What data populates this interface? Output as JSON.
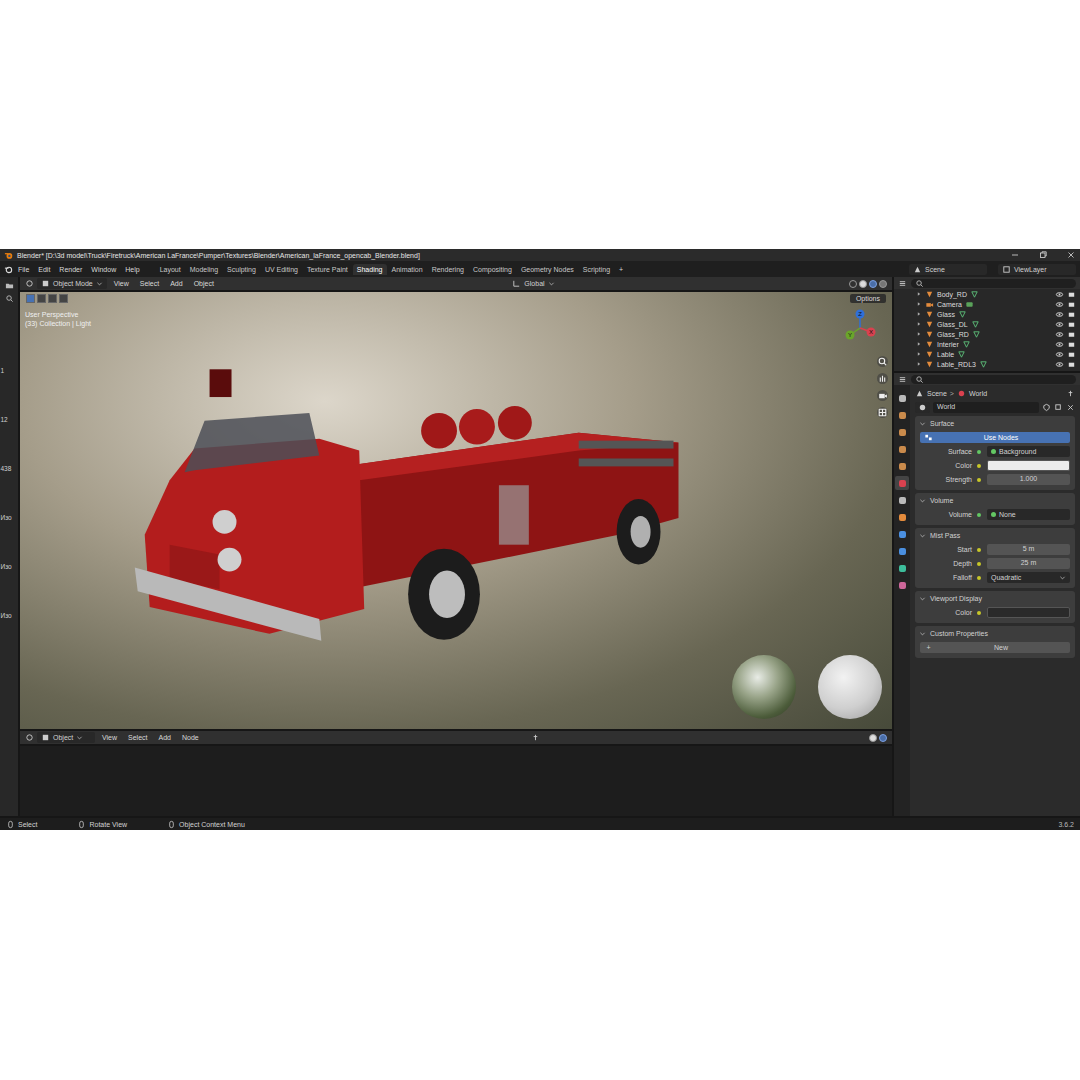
{
  "window": {
    "title": "Blender* [D:\\3d model\\Truck\\Firetruck\\American LaFrance\\Pumper\\Textures\\Blender\\American_laFrance_opencab_Blender.blend]"
  },
  "menu": [
    "File",
    "Edit",
    "Render",
    "Window",
    "Help"
  ],
  "workspaces": [
    {
      "label": "Layout",
      "selected": false
    },
    {
      "label": "Modeling",
      "selected": false
    },
    {
      "label": "Sculpting",
      "selected": false
    },
    {
      "label": "UV Editing",
      "selected": false
    },
    {
      "label": "Texture Paint",
      "selected": false
    },
    {
      "label": "Shading",
      "selected": true
    },
    {
      "label": "Animation",
      "selected": false
    },
    {
      "label": "Rendering",
      "selected": false
    },
    {
      "label": "Compositing",
      "selected": false
    },
    {
      "label": "Geometry Nodes",
      "selected": false
    },
    {
      "label": "Scripting",
      "selected": false
    }
  ],
  "add_workspace": "+",
  "scene": "Scene",
  "view_layer": "ViewLayer",
  "left_strip": [
    "1",
    "12",
    "438",
    "Изо",
    "Изо",
    "Изо"
  ],
  "viewport_header": {
    "mode": "Object Mode",
    "menus": [
      "View",
      "Select",
      "Add",
      "Object"
    ],
    "orientation": "Global",
    "options": "Options"
  },
  "viewport": {
    "overlay": [
      "User Perspective",
      "(33) Collection | Light"
    ],
    "gizmo": [
      {
        "label": "Z",
        "color": "#2f6fd8"
      },
      {
        "label": "Y",
        "color": "#6aa52a"
      },
      {
        "label": "X",
        "color": "#d9414f"
      }
    ]
  },
  "shader_header": {
    "type": "Object",
    "menus": [
      "View",
      "Select",
      "Add",
      "Node"
    ]
  },
  "outliner": {
    "items": [
      {
        "name": "Body_RD",
        "kind": "mesh"
      },
      {
        "name": "Camera",
        "kind": "camera"
      },
      {
        "name": "Glass",
        "kind": "mesh"
      },
      {
        "name": "Glass_DL",
        "kind": "mesh"
      },
      {
        "name": "Glass_RD",
        "kind": "mesh"
      },
      {
        "name": "Interier",
        "kind": "mesh"
      },
      {
        "name": "Lable",
        "kind": "mesh"
      },
      {
        "name": "Lable_RDL3",
        "kind": "mesh"
      }
    ]
  },
  "property_tabs": [
    {
      "selected": false
    },
    {
      "selected": false
    },
    {
      "selected": false
    },
    {
      "selected": false
    },
    {
      "selected": false
    },
    {
      "selected": true
    },
    {
      "selected": false
    },
    {
      "selected": false
    },
    {
      "selected": false
    },
    {
      "selected": false
    },
    {
      "selected": false
    },
    {
      "selected": false
    }
  ],
  "properties": {
    "breadcrumb": [
      "Scene",
      "World"
    ],
    "separator": ">",
    "datablock": "World",
    "panels": [
      {
        "title": "Surface",
        "expanded": true,
        "rows": [
          {
            "kind": "button",
            "value": "Use Nodes",
            "selected": true
          },
          {
            "kind": "socket",
            "label": "Surface",
            "value": "Background"
          },
          {
            "kind": "color",
            "label": "Color",
            "color": "#ececec"
          },
          {
            "kind": "number",
            "label": "Strength",
            "value": "1.000"
          }
        ]
      },
      {
        "title": "Volume",
        "expanded": true,
        "rows": [
          {
            "kind": "socket",
            "label": "Volume",
            "value": "None"
          }
        ]
      },
      {
        "title": "Mist Pass",
        "expanded": true,
        "rows": [
          {
            "kind": "number",
            "label": "Start",
            "value": "5 m"
          },
          {
            "kind": "number",
            "label": "Depth",
            "value": "25 m"
          },
          {
            "kind": "dropdown",
            "label": "Falloff",
            "value": "Quadratic"
          }
        ]
      },
      {
        "title": "Viewport Display",
        "expanded": true,
        "rows": [
          {
            "kind": "color",
            "label": "Color",
            "color": "#2a2a2a"
          }
        ]
      },
      {
        "title": "Custom Properties",
        "expanded": true,
        "rows": [
          {
            "kind": "add",
            "icon": "+",
            "value": "New"
          }
        ]
      }
    ]
  },
  "status_bar": {
    "items": [
      "Select",
      "Rotate View",
      "Object Context Menu"
    ],
    "version": "3.6.2"
  }
}
